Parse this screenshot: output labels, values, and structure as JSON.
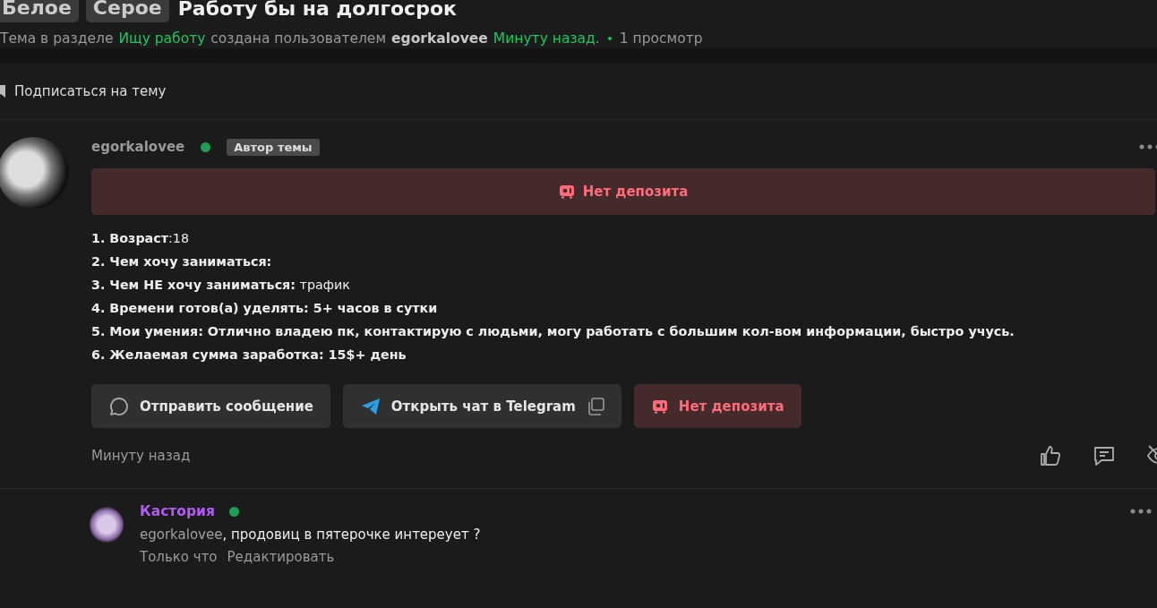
{
  "topic": {
    "tags": [
      "Белое",
      "Серое"
    ],
    "title": "Работу бы на долгосрок",
    "meta": {
      "prefix": "Тема в разделе",
      "section": "Ищу работу",
      "created_by": "создана пользователем",
      "author": "egorkalovee",
      "time": "Минуту назад.",
      "views": "1 просмотр"
    }
  },
  "subscribe": {
    "label": "Подписаться на тему"
  },
  "post": {
    "author": "egorkalovee",
    "online": true,
    "badge": "Автор темы",
    "deposit_banner": "Нет депозита",
    "lines": [
      "**1. Возраст**:18",
      "**2. Чем хочу заниматься:**",
      "**3. Чем НЕ хочу заниматься:** трафик",
      "**4. Времени готов(а) уделять: 5+ часов в сутки**",
      "**5. Мои умения: Отлично владею пк, контактирую с людьми, могу работать с большим кол-вом информации, быстро учусь.**",
      "**6. Желаемая сумма заработка: 15$+ день**"
    ],
    "buttons": [
      {
        "kind": "message",
        "label": "Отправить сообщение"
      },
      {
        "kind": "telegram",
        "label": "Открыть чат в Telegram"
      },
      {
        "kind": "deposit",
        "label": "Нет депозита"
      }
    ],
    "time": "Минуту назад"
  },
  "comment": {
    "author": "Кастория",
    "online": true,
    "mention": "egorkalovee",
    "text": ", продовиц в пятерочке интереует ?",
    "time": "Только что",
    "edit": "Редактировать"
  }
}
